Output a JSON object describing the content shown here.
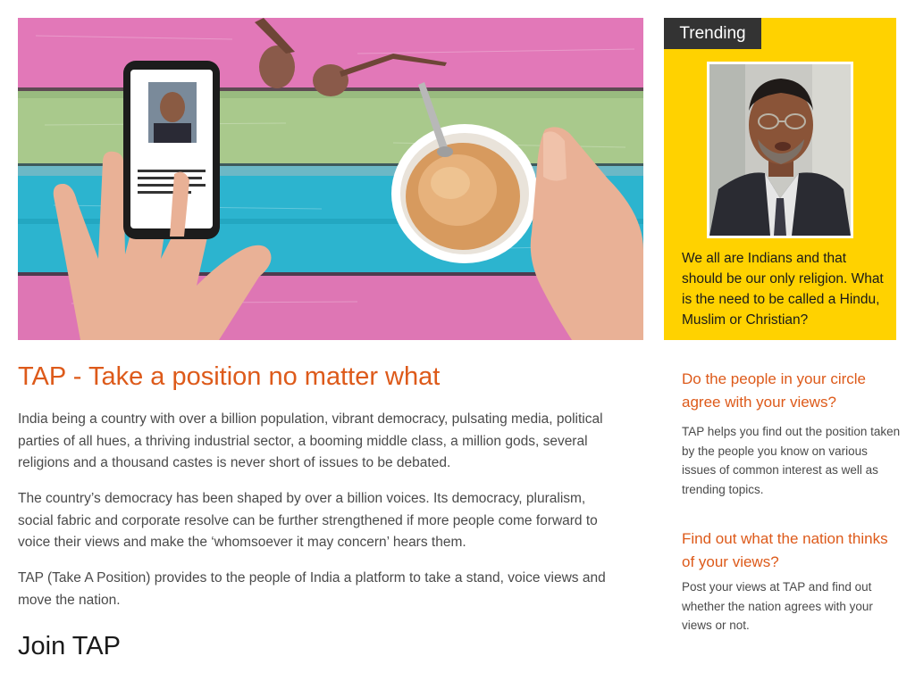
{
  "hero": {
    "phone_quote_fragment": "We all are Indians and that should be our only religion. What is the need to be called a Hindu, Muslim or Christian?"
  },
  "trending": {
    "tab_label": "Trending",
    "quote": "We all are Indians and that should be our only religion. What is the need to be called a Hindu, Muslim or Christian?"
  },
  "main": {
    "title": "TAP - Take a position no matter what",
    "paragraphs": [
      "India being a country with over a billion population, vibrant democracy, pulsating media, political parties of all hues, a thriving industrial sector, a booming middle class, a million gods, several religions and a thousand castes is never short of issues to be debated.",
      "The country’s democracy has been shaped by over a billion voices. Its democracy, pluralism, social fabric and corporate resolve can be further strengthened if more people come forward to voice their views and make the ‘whomsoever it may concern’ hears them.",
      "TAP (Take A Position) provides to the people of India a platform to take a stand, voice views and move the nation."
    ],
    "join_title": "Join TAP"
  },
  "sidebar": {
    "sections": [
      {
        "heading": "Do the people in your circle agree with your views?",
        "text": "TAP helps you find out the position taken by the people you know on various issues of common interest as well as trending topics."
      },
      {
        "heading": "Find out what the nation thinks of your views?",
        "text": "Post your views at TAP and find out whether the nation agrees with your views or not."
      }
    ]
  },
  "colors": {
    "accent": "#dd5a1a",
    "trending_bg": "#ffd200",
    "tab_bg": "#333333"
  }
}
